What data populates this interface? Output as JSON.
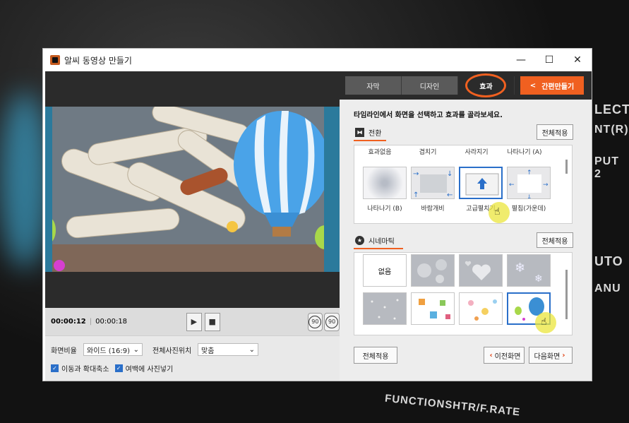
{
  "background": {
    "signs": [
      "LECT",
      "NT(R)",
      "PUT 2",
      "UTO",
      "ANU",
      "FUNCTION",
      "SHTR/F.RATE"
    ]
  },
  "window": {
    "title": "알씨 동영상 만들기",
    "controls": {
      "minimize": "—",
      "maximize": "☐",
      "close": "✕"
    }
  },
  "player": {
    "current_time": "00:00:12",
    "total_time": "00:00:18",
    "play_icon": "play-icon",
    "stop_icon": "stop-icon",
    "rotate_left_label": "90",
    "rotate_right_label": "90"
  },
  "settings": {
    "aspect_label": "화면비율",
    "aspect_value": "와이드 (16:9)",
    "position_label": "전체사진위치",
    "position_value": "맞춤",
    "check1_label": "이동과 확대축소",
    "check2_label": "여백에 사진넣기"
  },
  "tabs": [
    {
      "label": "자막"
    },
    {
      "label": "디자인"
    },
    {
      "label": "효과"
    }
  ],
  "quick_make_label": "간편만들기",
  "instruction": "타임라인에서 화면을 선택하고 효과를 골라보세요.",
  "transition": {
    "title": "전환",
    "apply_all": "전체적용",
    "top_labels": [
      "효과없음",
      "겹치기",
      "사라지기",
      "나타나기 (A)"
    ],
    "items": [
      {
        "label": "나타나기 (B)"
      },
      {
        "label": "바람개비"
      },
      {
        "label": "고급펼치기"
      },
      {
        "label": "펼침(가운데)"
      }
    ]
  },
  "cinematic": {
    "title": "시네마틱",
    "apply_all": "전체적용",
    "none_label": "없음"
  },
  "footer": {
    "apply_all": "전체적용",
    "prev": "이전화면",
    "next": "다음화면"
  },
  "colors": {
    "accent": "#f06020",
    "select": "#2a6fc9",
    "dark": "#2b2b2b"
  }
}
